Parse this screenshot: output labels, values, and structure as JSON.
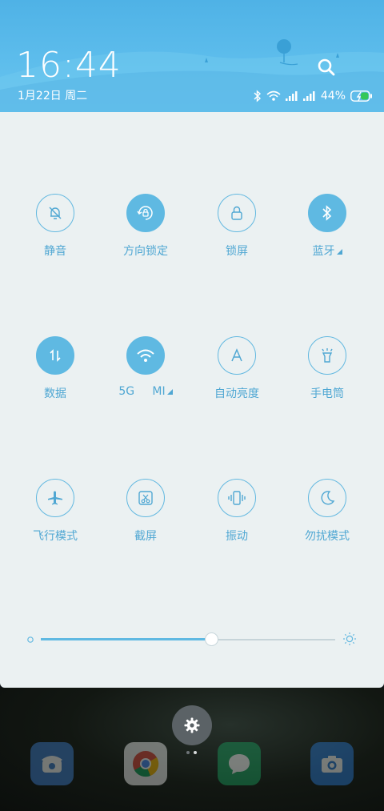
{
  "header": {
    "time": "16:44",
    "date": "1月22日 周二",
    "battery_percent": "44%",
    "search_icon": "search-icon"
  },
  "status_icons": [
    "bluetooth-icon",
    "wifi-icon",
    "signal-icon",
    "signal-icon",
    "battery-charging-icon"
  ],
  "toggles": [
    {
      "label": "静音",
      "icon": "bell-off-icon",
      "on": false
    },
    {
      "label": "方向锁定",
      "icon": "rotation-lock-icon",
      "on": true
    },
    {
      "label": "锁屏",
      "icon": "lock-icon",
      "on": false
    },
    {
      "label": "蓝牙",
      "icon": "bluetooth-icon",
      "on": true,
      "expandable": true
    },
    {
      "label": "数据",
      "icon": "mobile-data-icon",
      "on": true
    },
    {
      "label": "5G     MI",
      "icon": "wifi-icon",
      "on": true,
      "expandable": true
    },
    {
      "label": "自动亮度",
      "icon": "auto-brightness-icon",
      "on": false
    },
    {
      "label": "手电筒",
      "icon": "flashlight-icon",
      "on": false
    },
    {
      "label": "飞行模式",
      "icon": "airplane-icon",
      "on": false
    },
    {
      "label": "截屏",
      "icon": "screenshot-icon",
      "on": false
    },
    {
      "label": "振动",
      "icon": "vibrate-icon",
      "on": false
    },
    {
      "label": "勿扰模式",
      "icon": "moon-icon",
      "on": false
    }
  ],
  "brightness": {
    "level": 0.58
  },
  "dock": {
    "apps": [
      "phone-icon",
      "chrome-icon",
      "messages-icon",
      "camera-icon"
    ],
    "page_indicator": {
      "pages": 2,
      "current": 2
    }
  },
  "colors": {
    "accent": "#5fb9e2",
    "panel_bg": "#ebf1f2",
    "label": "#4fa7d3"
  }
}
